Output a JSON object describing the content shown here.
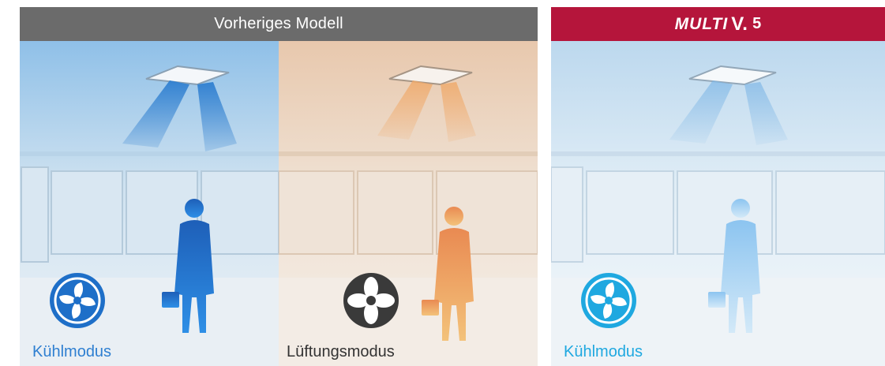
{
  "left_panel": {
    "header": "Vorheriges Modell",
    "header_color": "#6b6b6b",
    "scenes": [
      {
        "mode_label": "Kühlmodus",
        "mode_color": "#2e7fd1",
        "fan_icon": "cooling-fan-icon",
        "tint": "cool-blue"
      },
      {
        "mode_label": "Lüftungsmodus",
        "mode_color": "#333333",
        "fan_icon": "ventilation-fan-icon",
        "tint": "warm-orange"
      }
    ]
  },
  "right_panel": {
    "header_brand": "MULTI",
    "header_brand_v": "V.",
    "header_brand_num": "5",
    "header_color": "#b5153b",
    "scene": {
      "mode_label": "Kühlmodus",
      "mode_color": "#1fa8e0",
      "fan_icon": "cooling-fan-icon",
      "tint": "light-cool"
    }
  }
}
